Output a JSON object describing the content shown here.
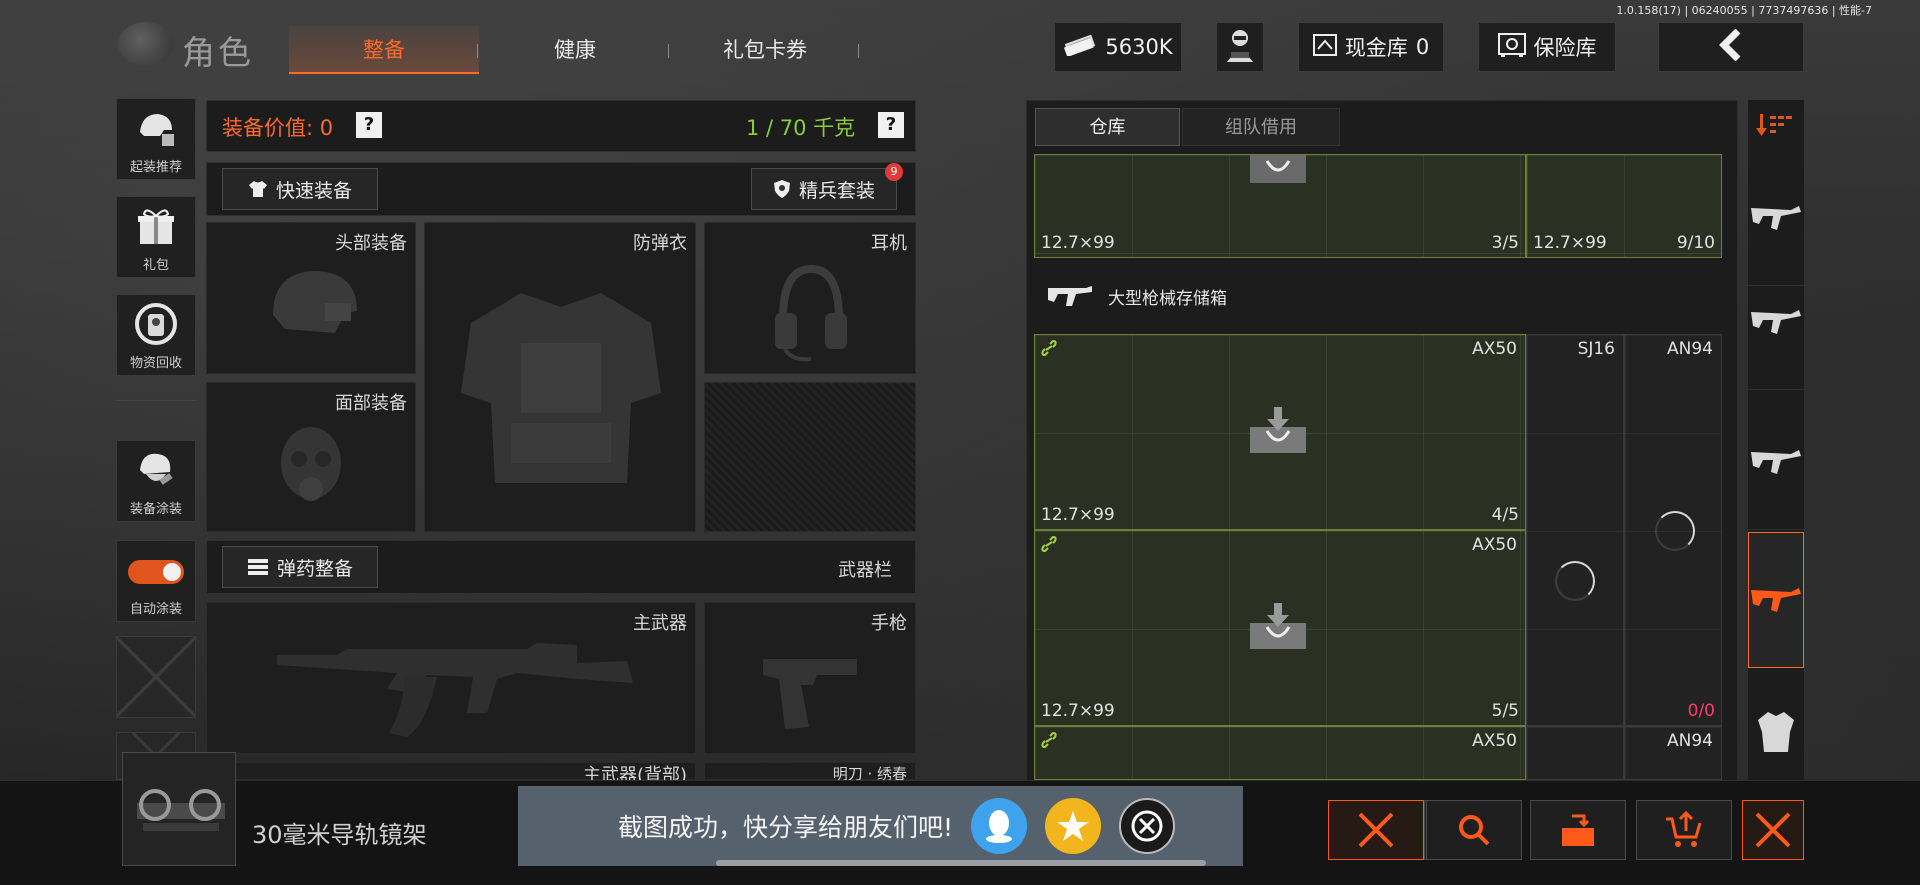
{
  "version": "1.0.158(17) | 06240055 | 7737497636 | 性能-7",
  "header": {
    "title": "角色",
    "tabs": [
      {
        "label": "整备",
        "active": true
      },
      {
        "label": "健康",
        "active": false
      },
      {
        "label": "礼包卡券",
        "active": false
      }
    ],
    "currency_value": "5630K",
    "cash_vault_label": "现金库",
    "cash_vault_value": "0",
    "safe_label": "保险库",
    "back_icon": "chevron-left-icon"
  },
  "sidebar": [
    {
      "label": "起装推荐",
      "icon": "helmet-gear-icon"
    },
    {
      "label": "礼包",
      "icon": "gift-icon"
    },
    {
      "label": "物资回收",
      "icon": "recycle-icon"
    },
    {
      "label": "装备涂装",
      "icon": "paint-helmet-icon"
    },
    {
      "label": "自动涂装",
      "icon": "toggle-switch",
      "toggle_on": true
    }
  ],
  "equipment": {
    "value_label": "装备价值:",
    "value": "0",
    "weight": "1 / 70 千克",
    "quick_equip": "快速装备",
    "elite_set": "精兵套装",
    "elite_badge": "9",
    "slots": {
      "head": "头部装备",
      "armor": "防弹衣",
      "headset": "耳机",
      "face": "面部装备",
      "primary": "主武器",
      "pistol": "手枪",
      "primary_back": "主武器(背部)",
      "melee": "明刀 · 绣春"
    },
    "ammo_btn": "弹药整备",
    "weapon_bar": "武器栏"
  },
  "warehouse": {
    "tabs": [
      {
        "label": "仓库",
        "active": true
      },
      {
        "label": "组队借用",
        "active": false
      }
    ],
    "top_row": [
      {
        "ammo": "12.7×99",
        "count": "3/5"
      },
      {
        "ammo": "12.7×99",
        "count": "9/10"
      }
    ],
    "storage_title": "大型枪械存储箱",
    "rows": [
      {
        "ammo": "12.7×99",
        "gun": "AX50",
        "count": "4/5",
        "slot2": "SJ16",
        "slot3": "AN94"
      },
      {
        "ammo": "12.7×99",
        "gun": "AX50",
        "count": "5/5",
        "slot3_count": "0/0"
      },
      {
        "gun": "AX50",
        "slot3": "AN94"
      }
    ]
  },
  "bottom": {
    "item_name": "30毫米导轨镜架",
    "toast": "截图成功，快分享给朋友们吧!",
    "buttons": [
      "close-icon",
      "search-icon",
      "storage-box-icon",
      "cart-upload-icon",
      "close-icon"
    ]
  },
  "colors": {
    "accent": "#ff6a2a",
    "weight_green": "#8ccb3a",
    "slot_green_border": "#6e7d3c"
  }
}
